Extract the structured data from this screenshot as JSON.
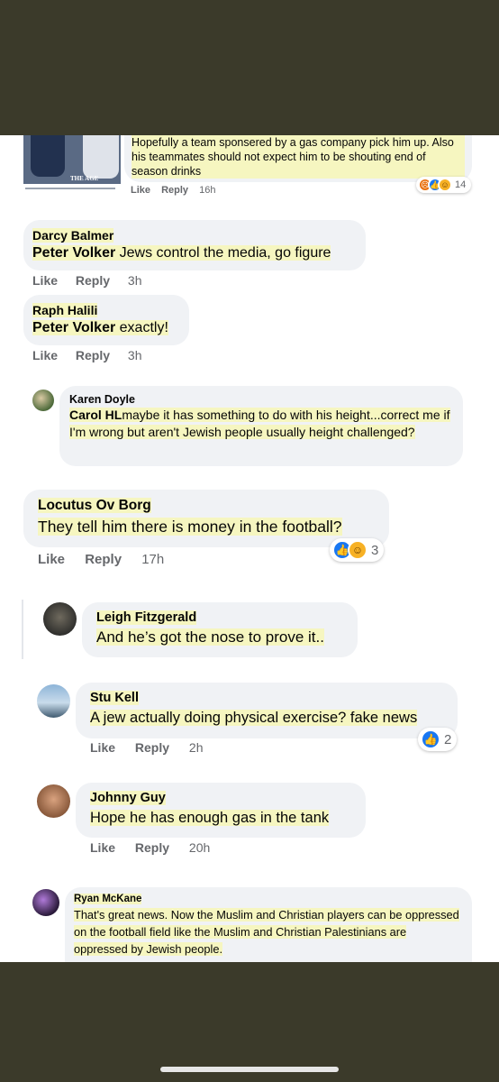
{
  "comments": [
    {
      "id": "top",
      "thumb_caption": "Hopefully a team sponsered by a gas company pick him up. Also his teammates should not expect him to be shouting end of season drinks",
      "thumb_logo": "THE AGE",
      "actions": {
        "like": "Like",
        "reply": "Reply",
        "time": "16h"
      },
      "reactions": {
        "count": "14",
        "types": [
          "angry",
          "like",
          "haha"
        ]
      }
    },
    {
      "id": "darcy",
      "name": "Darcy Balmer",
      "tag": "Peter Volker",
      "text": " Jews control the media, go figure",
      "actions": {
        "like": "Like",
        "reply": "Reply",
        "time": "3h"
      }
    },
    {
      "id": "raph",
      "name": "Raph Halili",
      "tag": "Peter Volker",
      "text": " exactly!",
      "actions": {
        "like": "Like",
        "reply": "Reply",
        "time": "3h"
      }
    },
    {
      "id": "karen",
      "name": "Karen Doyle",
      "tag": "Carol HL",
      "text": "maybe it has something to do with his height...correct me if I'm wrong but aren't Jewish people usually height challenged?"
    },
    {
      "id": "locutus",
      "name": "Locutus Ov Borg",
      "text": "They tell him there is money in the football?",
      "actions": {
        "like": "Like",
        "reply": "Reply",
        "time": "17h"
      },
      "reactions": {
        "count": "3",
        "types": [
          "like",
          "haha"
        ]
      }
    },
    {
      "id": "leigh",
      "name": "Leigh Fitzgerald",
      "text": "And he’s got the nose to prove it.."
    },
    {
      "id": "stu",
      "name": "Stu Kell",
      "text": "A jew actually doing physical exercise? fake news",
      "actions": {
        "like": "Like",
        "reply": "Reply",
        "time": "2h"
      },
      "reactions": {
        "count": "2",
        "types": [
          "like"
        ]
      }
    },
    {
      "id": "johnny",
      "name": "Johnny Guy",
      "text": "Hope he has enough gas in the tank",
      "actions": {
        "like": "Like",
        "reply": "Reply",
        "time": "20h"
      }
    },
    {
      "id": "ryan",
      "name": "Ryan McKane",
      "text": "That's great news. Now the Muslim and Christian players can be oppressed on the football field like the Muslim and Christian Palestinians are oppressed by Jewish people."
    }
  ],
  "colors": {
    "background": "#3b3a2a",
    "bubble": "#f0f2f5",
    "highlight": "#f6f6c0",
    "meta": "#65676b",
    "like": "#1877f2"
  }
}
